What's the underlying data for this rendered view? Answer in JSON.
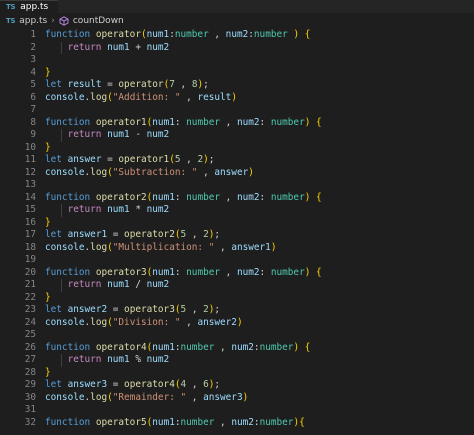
{
  "tab": {
    "badge": "TS",
    "filename": "app.ts"
  },
  "breadcrumb": {
    "file": "app.ts",
    "separator": "›",
    "symbol": "countDown"
  },
  "editor": {
    "lines": [
      [
        [
          "function",
          "kw"
        ],
        [
          " ",
          "pn"
        ],
        [
          "operator",
          "fn"
        ],
        [
          "(",
          "br1"
        ],
        [
          "num1",
          "var"
        ],
        [
          ":",
          "pn"
        ],
        [
          "number",
          "type"
        ],
        [
          " , ",
          "pn"
        ],
        [
          "num2",
          "var"
        ],
        [
          ":",
          "pn"
        ],
        [
          "number",
          "type"
        ],
        [
          " ",
          "pn"
        ],
        [
          ")",
          "br1"
        ],
        [
          " ",
          "pn"
        ],
        [
          "{",
          "br1"
        ]
      ],
      [
        [
          "    ",
          "pn"
        ],
        [
          "return",
          "ctl"
        ],
        [
          " ",
          "pn"
        ],
        [
          "num1",
          "var"
        ],
        [
          " + ",
          "pn"
        ],
        [
          "num2",
          "var"
        ]
      ],
      [],
      [
        [
          "}",
          "br1"
        ]
      ],
      [
        [
          "let",
          "kw"
        ],
        [
          " ",
          "pn"
        ],
        [
          "result",
          "var"
        ],
        [
          " = ",
          "pn"
        ],
        [
          "operator",
          "fn"
        ],
        [
          "(",
          "br1"
        ],
        [
          "7",
          "num"
        ],
        [
          " , ",
          "pn"
        ],
        [
          "8",
          "num"
        ],
        [
          ")",
          "br1"
        ],
        [
          ";",
          "pn"
        ]
      ],
      [
        [
          "console",
          "obj"
        ],
        [
          ".",
          "pn"
        ],
        [
          "log",
          "fn"
        ],
        [
          "(",
          "br1"
        ],
        [
          "\"Addition: \"",
          "str"
        ],
        [
          " , ",
          "pn"
        ],
        [
          "result",
          "var"
        ],
        [
          ")",
          "br1"
        ]
      ],
      [],
      [
        [
          "function",
          "kw"
        ],
        [
          " ",
          "pn"
        ],
        [
          "operator1",
          "fn"
        ],
        [
          "(",
          "br1"
        ],
        [
          "num1",
          "var"
        ],
        [
          ": ",
          "pn"
        ],
        [
          "number",
          "type"
        ],
        [
          " , ",
          "pn"
        ],
        [
          "num2",
          "var"
        ],
        [
          ": ",
          "pn"
        ],
        [
          "number",
          "type"
        ],
        [
          ")",
          "br1"
        ],
        [
          " ",
          "pn"
        ],
        [
          "{",
          "br1"
        ]
      ],
      [
        [
          "    ",
          "pn"
        ],
        [
          "return",
          "ctl"
        ],
        [
          " ",
          "pn"
        ],
        [
          "num1",
          "var"
        ],
        [
          " - ",
          "pn"
        ],
        [
          "num2",
          "var"
        ]
      ],
      [
        [
          "}",
          "br1"
        ]
      ],
      [
        [
          "let",
          "kw"
        ],
        [
          " ",
          "pn"
        ],
        [
          "answer",
          "var"
        ],
        [
          " = ",
          "pn"
        ],
        [
          "operator1",
          "fn"
        ],
        [
          "(",
          "br1"
        ],
        [
          "5",
          "num"
        ],
        [
          " , ",
          "pn"
        ],
        [
          "2",
          "num"
        ],
        [
          ")",
          "br1"
        ],
        [
          ";",
          "pn"
        ]
      ],
      [
        [
          "console",
          "obj"
        ],
        [
          ".",
          "pn"
        ],
        [
          "log",
          "fn"
        ],
        [
          "(",
          "br1"
        ],
        [
          "\"Subtraction: \"",
          "str"
        ],
        [
          " , ",
          "pn"
        ],
        [
          "answer",
          "var"
        ],
        [
          ")",
          "br1"
        ]
      ],
      [],
      [
        [
          "function",
          "kw"
        ],
        [
          " ",
          "pn"
        ],
        [
          "operator2",
          "fn"
        ],
        [
          "(",
          "br1"
        ],
        [
          "num1",
          "var"
        ],
        [
          ": ",
          "pn"
        ],
        [
          "number",
          "type"
        ],
        [
          " , ",
          "pn"
        ],
        [
          "num2",
          "var"
        ],
        [
          ": ",
          "pn"
        ],
        [
          "number",
          "type"
        ],
        [
          ")",
          "br1"
        ],
        [
          " ",
          "pn"
        ],
        [
          "{",
          "br1"
        ]
      ],
      [
        [
          "    ",
          "pn"
        ],
        [
          "return",
          "ctl"
        ],
        [
          " ",
          "pn"
        ],
        [
          "num1",
          "var"
        ],
        [
          " * ",
          "pn"
        ],
        [
          "num2",
          "var"
        ]
      ],
      [
        [
          "}",
          "br1"
        ]
      ],
      [
        [
          "let",
          "kw"
        ],
        [
          " ",
          "pn"
        ],
        [
          "answer1",
          "var"
        ],
        [
          " = ",
          "pn"
        ],
        [
          "operator2",
          "fn"
        ],
        [
          "(",
          "br1"
        ],
        [
          "5",
          "num"
        ],
        [
          " , ",
          "pn"
        ],
        [
          "2",
          "num"
        ],
        [
          ")",
          "br1"
        ],
        [
          ";",
          "pn"
        ]
      ],
      [
        [
          "console",
          "obj"
        ],
        [
          ".",
          "pn"
        ],
        [
          "log",
          "fn"
        ],
        [
          "(",
          "br1"
        ],
        [
          "\"Multiplication: \"",
          "str"
        ],
        [
          " , ",
          "pn"
        ],
        [
          "answer1",
          "var"
        ],
        [
          ")",
          "br1"
        ]
      ],
      [],
      [
        [
          "function",
          "kw"
        ],
        [
          " ",
          "pn"
        ],
        [
          "operator3",
          "fn"
        ],
        [
          "(",
          "br1"
        ],
        [
          "num1",
          "var"
        ],
        [
          ": ",
          "pn"
        ],
        [
          "number",
          "type"
        ],
        [
          " , ",
          "pn"
        ],
        [
          "num2",
          "var"
        ],
        [
          ": ",
          "pn"
        ],
        [
          "number",
          "type"
        ],
        [
          ")",
          "br1"
        ],
        [
          " ",
          "pn"
        ],
        [
          "{",
          "br1"
        ]
      ],
      [
        [
          "    ",
          "pn"
        ],
        [
          "return",
          "ctl"
        ],
        [
          " ",
          "pn"
        ],
        [
          "num1",
          "var"
        ],
        [
          " / ",
          "pn"
        ],
        [
          "num2",
          "var"
        ]
      ],
      [
        [
          "}",
          "br1"
        ]
      ],
      [
        [
          "let",
          "kw"
        ],
        [
          " ",
          "pn"
        ],
        [
          "answer2",
          "var"
        ],
        [
          " = ",
          "pn"
        ],
        [
          "operator3",
          "fn"
        ],
        [
          "(",
          "br1"
        ],
        [
          "5",
          "num"
        ],
        [
          " , ",
          "pn"
        ],
        [
          "2",
          "num"
        ],
        [
          ")",
          "br1"
        ],
        [
          ";",
          "pn"
        ]
      ],
      [
        [
          "console",
          "obj"
        ],
        [
          ".",
          "pn"
        ],
        [
          "log",
          "fn"
        ],
        [
          "(",
          "br1"
        ],
        [
          "\"Division: \"",
          "str"
        ],
        [
          " , ",
          "pn"
        ],
        [
          "answer2",
          "var"
        ],
        [
          ")",
          "br1"
        ]
      ],
      [],
      [
        [
          "function",
          "kw"
        ],
        [
          " ",
          "pn"
        ],
        [
          "operator4",
          "fn"
        ],
        [
          "(",
          "br1"
        ],
        [
          "num1",
          "var"
        ],
        [
          ":",
          "pn"
        ],
        [
          "number",
          "type"
        ],
        [
          " , ",
          "pn"
        ],
        [
          "num2",
          "var"
        ],
        [
          ":",
          "pn"
        ],
        [
          "number",
          "type"
        ],
        [
          ")",
          "br1"
        ],
        [
          " ",
          "pn"
        ],
        [
          "{",
          "br1"
        ]
      ],
      [
        [
          "    ",
          "pn"
        ],
        [
          "return",
          "ctl"
        ],
        [
          " ",
          "pn"
        ],
        [
          "num1",
          "var"
        ],
        [
          " % ",
          "pn"
        ],
        [
          "num2",
          "var"
        ]
      ],
      [
        [
          "}",
          "br1"
        ]
      ],
      [
        [
          "let",
          "kw"
        ],
        [
          " ",
          "pn"
        ],
        [
          "answer3",
          "var"
        ],
        [
          " = ",
          "pn"
        ],
        [
          "operator4",
          "fn"
        ],
        [
          "(",
          "br1"
        ],
        [
          "4",
          "num"
        ],
        [
          " , ",
          "pn"
        ],
        [
          "6",
          "num"
        ],
        [
          ")",
          "br1"
        ],
        [
          ";",
          "pn"
        ]
      ],
      [
        [
          "console",
          "obj"
        ],
        [
          ".",
          "pn"
        ],
        [
          "log",
          "fn"
        ],
        [
          "(",
          "br1"
        ],
        [
          "\"Remainder: \"",
          "str"
        ],
        [
          " , ",
          "pn"
        ],
        [
          "answer3",
          "var"
        ],
        [
          ")",
          "br1"
        ]
      ],
      [],
      [
        [
          "function",
          "kw"
        ],
        [
          " ",
          "pn"
        ],
        [
          "operator5",
          "fn"
        ],
        [
          "(",
          "br1"
        ],
        [
          "num1",
          "var"
        ],
        [
          ":",
          "pn"
        ],
        [
          "number",
          "type"
        ],
        [
          " , ",
          "pn"
        ],
        [
          "num2",
          "var"
        ],
        [
          ":",
          "pn"
        ],
        [
          "number",
          "type"
        ],
        [
          ")",
          "br1"
        ],
        [
          "{",
          "br1"
        ]
      ]
    ]
  },
  "colors": {
    "editor_bg": "#1e1e1e",
    "keyword": "#569cd6",
    "control": "#c586c0",
    "function": "#dcdcaa",
    "variable": "#9cdcfe",
    "type": "#4ec9b0",
    "number": "#b5cea8",
    "string": "#ce9178",
    "bracket": "#ffd700"
  }
}
